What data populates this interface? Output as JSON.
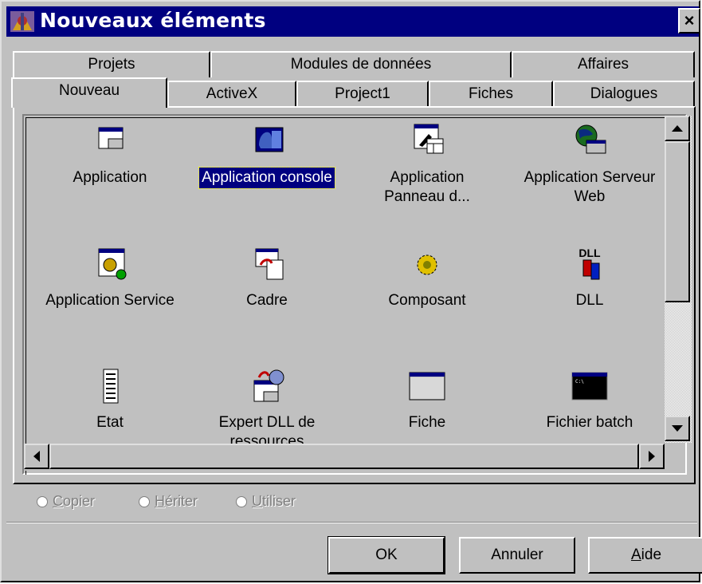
{
  "window": {
    "title": "Nouveaux éléments",
    "close_glyph": "×",
    "titlebar_color": "#000080"
  },
  "tabs_back": [
    {
      "label": "Projets"
    },
    {
      "label": "Modules de données"
    },
    {
      "label": "Affaires"
    }
  ],
  "tabs_front": [
    {
      "label": "Nouveau",
      "active": true
    },
    {
      "label": "ActiveX"
    },
    {
      "label": "Project1"
    },
    {
      "label": "Fiches"
    },
    {
      "label": "Dialogues"
    }
  ],
  "items": [
    {
      "label": "Application",
      "icon": "application-window-icon"
    },
    {
      "label": "Application console",
      "icon": "console-application-icon",
      "selected": true
    },
    {
      "label": "Application Panneau d...",
      "icon": "control-panel-application-icon"
    },
    {
      "label": "Application Serveur Web",
      "icon": "web-server-application-icon"
    },
    {
      "label": "Application Service",
      "icon": "service-application-icon"
    },
    {
      "label": "Cadre",
      "icon": "frame-icon"
    },
    {
      "label": "Composant",
      "icon": "component-gear-icon"
    },
    {
      "label": "DLL",
      "icon": "dll-icon"
    },
    {
      "label": "Etat",
      "icon": "report-icon"
    },
    {
      "label": "Expert DLL de ressources",
      "icon": "resource-dll-wizard-icon"
    },
    {
      "label": "Fiche",
      "icon": "form-icon"
    },
    {
      "label": "Fichier batch",
      "icon": "batch-file-icon"
    }
  ],
  "options": [
    {
      "label_ul": "C",
      "label_rest": "opier"
    },
    {
      "label_ul": "H",
      "label_rest": "ériter"
    },
    {
      "label_ul": "U",
      "label_rest": "tiliser"
    }
  ],
  "buttons": {
    "ok": "OK",
    "cancel": "Annuler",
    "help_ul": "A",
    "help_rest": "ide"
  }
}
